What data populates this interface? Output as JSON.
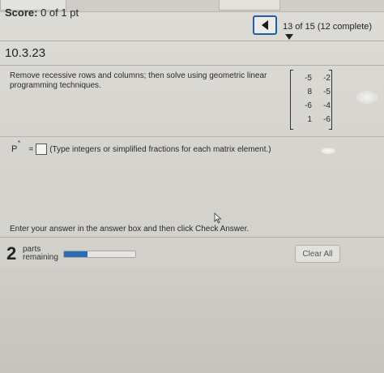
{
  "header": {
    "score_label": "Score:",
    "score_value": "0 of 1 pt",
    "progress": "13 of 15 (12 complete)"
  },
  "question": {
    "number": "10.3.23",
    "text": "Remove recessive rows and columns; then solve using geometric linear programming techniques.",
    "matrix": [
      [
        "-5",
        "-2"
      ],
      [
        "8",
        "-5"
      ],
      [
        "-6",
        "-4"
      ],
      [
        "1",
        "-6"
      ]
    ]
  },
  "answer": {
    "variable": "P",
    "superscript": "*",
    "equals": "=",
    "hint": "(Type integers or simplified fractions for each matrix element.)"
  },
  "instruction": "Enter your answer in the answer box and then click Check Answer.",
  "footer": {
    "parts_count": "2",
    "parts_label_1": "parts",
    "parts_label_2": "remaining",
    "progress_fraction": 0.33,
    "clear_label": "Clear All"
  },
  "colors": {
    "accent": "#2b6db3",
    "nav_border": "#1f5fa8"
  },
  "icons": {
    "nav": "triangle-left-icon",
    "dropdown": "triangle-down-icon",
    "cursor": "mouse-pointer-icon"
  }
}
